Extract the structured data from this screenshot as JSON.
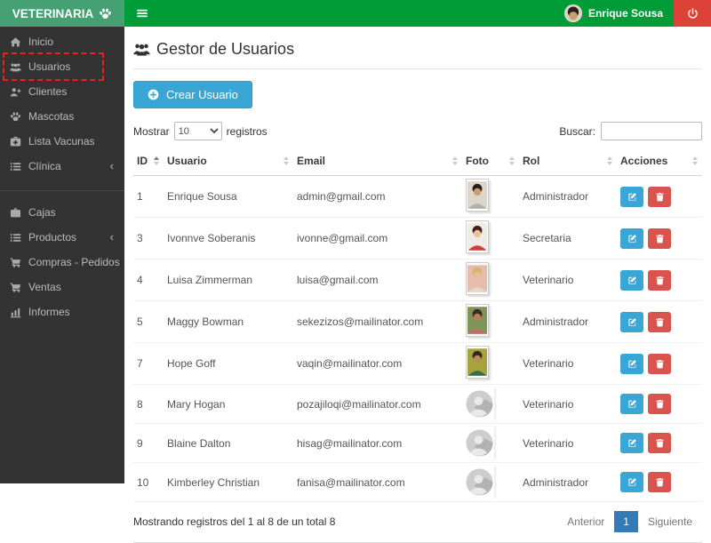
{
  "header": {
    "brand": "VETERINARIA",
    "user": {
      "name": "Enrique Sousa"
    }
  },
  "sidebar": {
    "items": [
      {
        "label": "Inicio",
        "icon": "home"
      },
      {
        "label": "Usuarios",
        "icon": "users",
        "active": true
      },
      {
        "label": "Clientes",
        "icon": "user-plus"
      },
      {
        "label": "Mascotas",
        "icon": "paw"
      },
      {
        "label": "Lista Vacunas",
        "icon": "medkit"
      },
      {
        "label": "Clínica",
        "icon": "list",
        "collapsed": true
      },
      {
        "label": "Cajas",
        "icon": "briefcase"
      },
      {
        "label": "Productos",
        "icon": "list",
        "collapsed": true
      },
      {
        "label": "Compras - Pedidos",
        "icon": "cart"
      },
      {
        "label": "Ventas",
        "icon": "cart"
      },
      {
        "label": "Informes",
        "icon": "bar-chart"
      }
    ]
  },
  "main": {
    "title": "Gestor de Usuarios",
    "create_button": "Crear Usuario",
    "length_control": {
      "before": "Mostrar",
      "value": "10",
      "after": "registros"
    },
    "search": {
      "label": "Buscar:",
      "value": ""
    },
    "table": {
      "columns": [
        "ID",
        "Usuario",
        "Email",
        "Foto",
        "Rol",
        "Acciones"
      ],
      "rows": [
        {
          "id": "1",
          "usuario": "Enrique Sousa",
          "email": "admin@gmail.com",
          "foto": "portrait",
          "rol": "Administrador"
        },
        {
          "id": "3",
          "usuario": "Ivonnve Soberanis",
          "email": "ivonne@gmail.com",
          "foto": "portrait",
          "rol": "Secretaria"
        },
        {
          "id": "4",
          "usuario": "Luisa Zimmerman",
          "email": "luisa@gmail.com",
          "foto": "portrait",
          "rol": "Veterinario"
        },
        {
          "id": "5",
          "usuario": "Maggy Bowman",
          "email": "sekezizos@mailinator.com",
          "foto": "portrait",
          "rol": "Administrador"
        },
        {
          "id": "7",
          "usuario": "Hope Goff",
          "email": "vaqin@mailinator.com",
          "foto": "portrait",
          "rol": "Veterinario"
        },
        {
          "id": "8",
          "usuario": "Mary Hogan",
          "email": "pozajiloqi@mailinator.com",
          "foto": "placeholder",
          "rol": "Veterinario"
        },
        {
          "id": "9",
          "usuario": "Blaine Dalton",
          "email": "hisag@mailinator.com",
          "foto": "placeholder",
          "rol": "Veterinario"
        },
        {
          "id": "10",
          "usuario": "Kimberley Christian",
          "email": "fanisa@mailinator.com",
          "foto": "placeholder",
          "rol": "Administrador"
        }
      ]
    },
    "footer_info": "Mostrando registros del 1 al 8 de un total 8",
    "pagination": {
      "prev": "Anterior",
      "page": "1",
      "next": "Siguiente"
    }
  },
  "icons": {
    "chevron_collapsed": "‹"
  },
  "colors": {
    "brand_bg": "#45a173",
    "navbar_bg": "#009c38",
    "sidebar_bg": "#333333",
    "logout_bg": "#dc4237",
    "primary_button": "#39a6d6",
    "delete_button": "#d9534f",
    "pagination_active": "#337ab7",
    "annotation_red": "#ef1f1a"
  }
}
